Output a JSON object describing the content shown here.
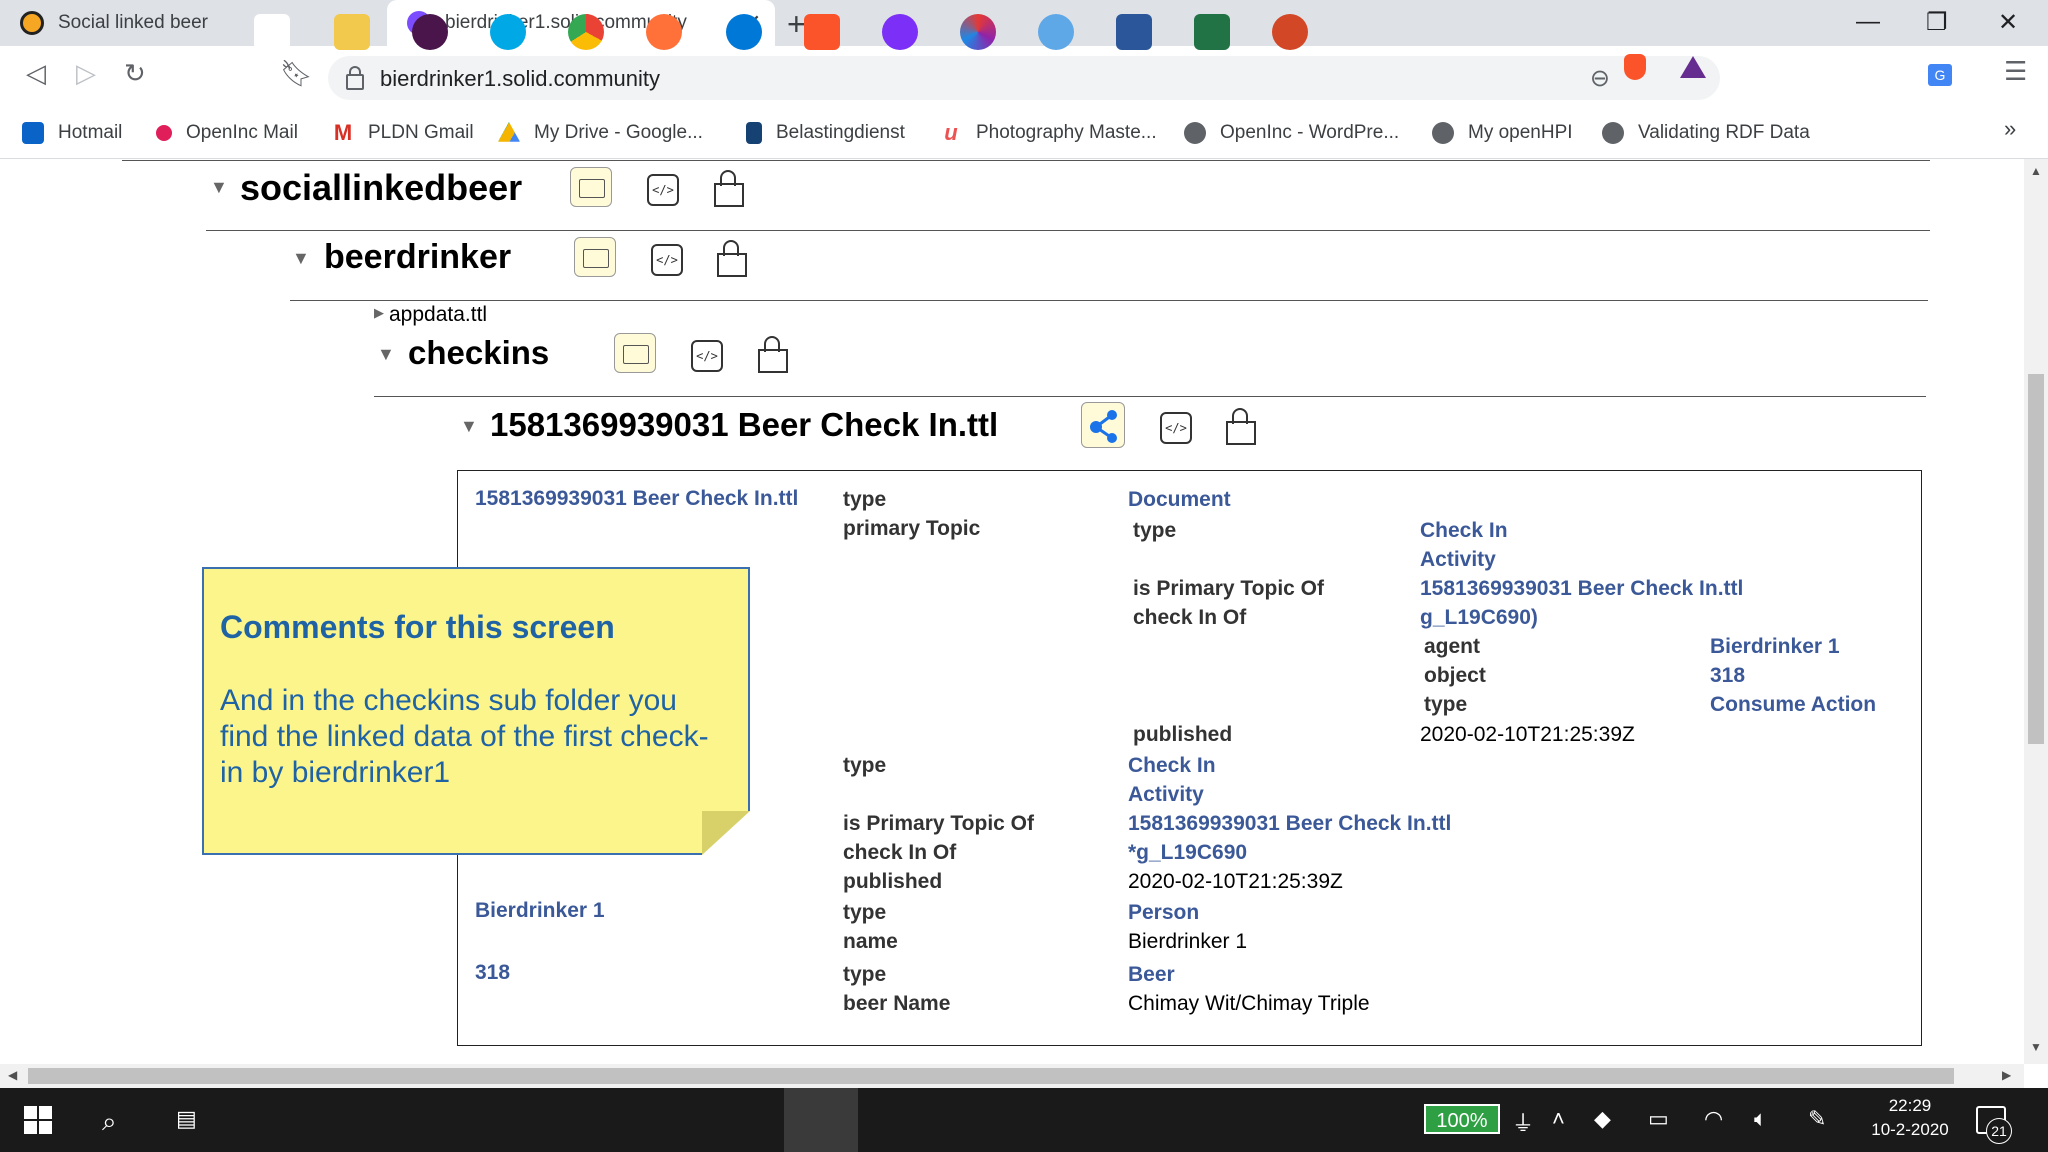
{
  "browser": {
    "tabs": [
      {
        "title": "Social linked beer",
        "active": false
      },
      {
        "title": "bierdrinker1.solid.community",
        "active": true
      }
    ],
    "new_tab": "+",
    "url": "bierdrinker1.solid.community",
    "bookmarks": [
      {
        "label": "Hotmail",
        "icon": "outlook-icon"
      },
      {
        "label": "OpenInc Mail",
        "icon": "slack-like-icon"
      },
      {
        "label": "PLDN Gmail",
        "icon": "gmail-icon"
      },
      {
        "label": "My Drive - Google...",
        "icon": "google-drive-icon"
      },
      {
        "label": "Belastingdienst",
        "icon": "belastingdienst-icon"
      },
      {
        "label": "Photography Maste...",
        "icon": "udemy-icon"
      },
      {
        "label": "OpenInc - WordPre...",
        "icon": "globe-icon"
      },
      {
        "label": "My openHPI",
        "icon": "globe-icon"
      },
      {
        "label": "Validating RDF Data",
        "icon": "globe-icon"
      }
    ],
    "bookmarks_more": "»"
  },
  "tree": {
    "level1": {
      "title": "sociallinkedbeer"
    },
    "level2": {
      "title": "beerdrinker"
    },
    "file_appdata": "appdata.ttl",
    "level3": {
      "title": "checkins"
    },
    "level4": {
      "title": "1581369939031 Beer Check In.ttl"
    }
  },
  "table": {
    "subject1": "1581369939031 Beer Check In.ttl",
    "rows": {
      "r1_pred": "type",
      "r1_obj": "Document",
      "r2_pred": "primary Topic",
      "r2_sub_pred1": "type",
      "r2_sub_obj1a": "Check In",
      "r2_sub_obj1b": "Activity",
      "r2_sub_pred2": "is Primary Topic Of",
      "r2_sub_obj2": "1581369939031 Beer Check In.ttl",
      "r2_sub_pred3": "check In Of",
      "r2_sub_obj3": "g_L19C690)",
      "r2_deep_pred1": "agent",
      "r2_deep_obj1": "Bierdrinker 1",
      "r2_deep_pred2": "object",
      "r2_deep_obj2": "318",
      "r2_deep_pred3": "type",
      "r2_deep_obj3": "Consume Action",
      "r2_sub_pred4": "published",
      "r2_sub_obj4": "2020-02-10T21:25:39Z",
      "b_pred1": "type",
      "b_obj1a": "Check In",
      "b_obj1b": "Activity",
      "b_pred2": "is Primary Topic Of",
      "b_obj2": "1581369939031 Beer Check In.ttl",
      "b_pred3": "check In Of",
      "b_obj3": "*g_L19C690",
      "b_pred4": "published",
      "b_obj4": "2020-02-10T21:25:39Z",
      "subject2": "Bierdrinker 1",
      "s2_pred1": "type",
      "s2_obj1": "Person",
      "s2_pred2": "name",
      "s2_obj2": "Bierdrinker 1",
      "subject3": "318",
      "s3_pred1": "type",
      "s3_obj1": "Beer",
      "s3_pred2": "beer Name",
      "s3_obj2": "Chimay Wit/Chimay Triple"
    }
  },
  "note": {
    "title": "Comments for this screen",
    "body": "And in the checkins sub folder you find the linked data of the first check-in by bierdrinker1"
  },
  "taskbar": {
    "battery": "100%",
    "time": "22:29",
    "date": "10-2-2020",
    "notifications": "21"
  },
  "colors": {
    "link": "#3b5998",
    "note_bg": "#fbf58c",
    "note_text": "#1f63a5",
    "folder_icon_bg": "#fffbd8"
  }
}
